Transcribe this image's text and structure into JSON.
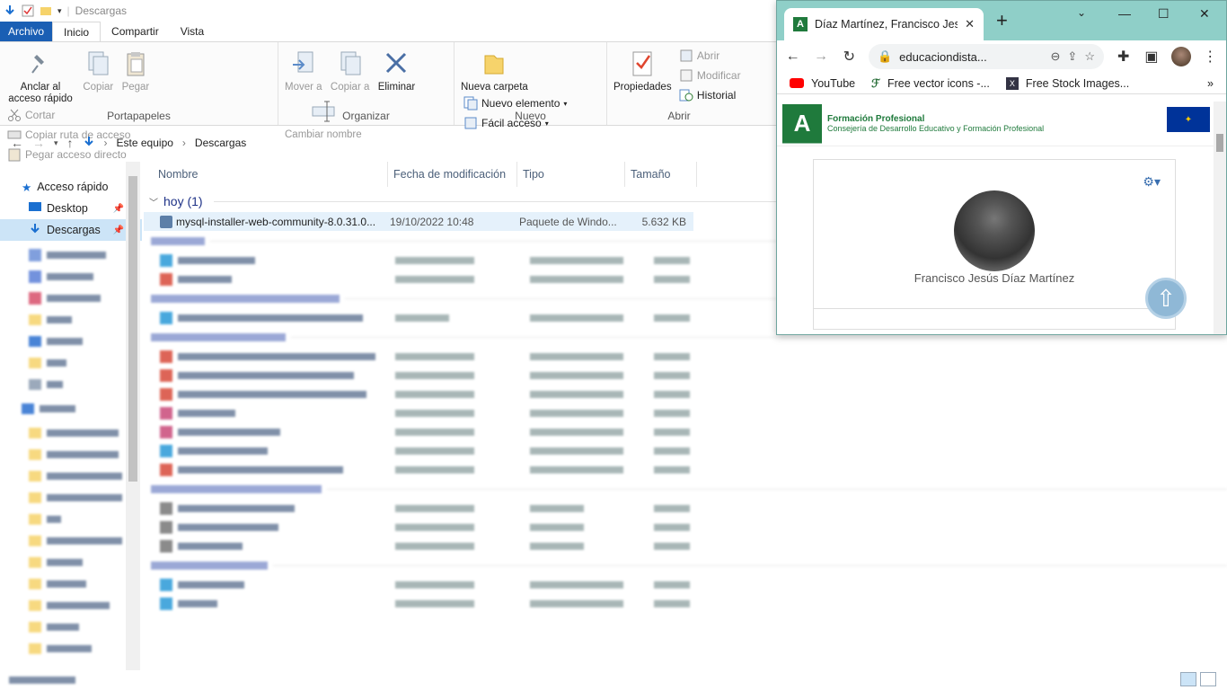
{
  "explorer": {
    "window_title": "Descargas",
    "ribbon_tabs": [
      "Archivo",
      "Inicio",
      "Compartir",
      "Vista"
    ],
    "groups": {
      "portapapeles": {
        "label": "Portapapeles",
        "anclar": "Anclar al acceso rápido",
        "copiar": "Copiar",
        "pegar": "Pegar",
        "cortar": "Cortar",
        "copiar_ruta": "Copiar ruta de acceso",
        "pegar_acceso": "Pegar acceso directo"
      },
      "organizar": {
        "label": "Organizar",
        "mover": "Mover a",
        "copiar_a": "Copiar a",
        "eliminar": "Eliminar",
        "cambiar": "Cambiar nombre"
      },
      "nuevo": {
        "label": "Nuevo",
        "carpeta": "Nueva carpeta",
        "nuevo_elemento": "Nuevo elemento",
        "facil_acceso": "Fácil acceso"
      },
      "abrir": {
        "label": "Abrir",
        "propiedades": "Propiedades",
        "abrir": "Abrir",
        "modificar": "Modificar",
        "historial": "Historial"
      }
    },
    "address": {
      "root": "Este equipo",
      "current": "Descargas"
    },
    "nav": {
      "items": [
        {
          "label": "Acceso rápido",
          "icon": "star-icon",
          "selected": false,
          "pinned": false
        },
        {
          "label": "Desktop",
          "icon": "desktop-icon",
          "selected": false,
          "pinned": true
        },
        {
          "label": "Descargas",
          "icon": "download-icon",
          "selected": true,
          "pinned": true
        }
      ]
    },
    "columns": [
      "Nombre",
      "Fecha de modificación",
      "Tipo",
      "Tamaño"
    ],
    "groups_list": {
      "today": {
        "label": "hoy (1)"
      }
    },
    "files": [
      {
        "name": "mysql-installer-web-community-8.0.31.0...",
        "date": "19/10/2022 10:48",
        "type": "Paquete de Windo...",
        "size": "5.632 KB"
      }
    ]
  },
  "chrome": {
    "tab_title": "Díaz Martínez, Francisco Jesús",
    "url": "educaciondista...",
    "bookmarks": [
      "YouTube",
      "Free vector icons -...",
      "Free Stock Images..."
    ],
    "page": {
      "org_title": "Formación Profesional",
      "org_subtitle": "Consejería de Desarrollo Educativo y Formación Profesional",
      "profile_name": "Francisco Jesús Díaz Martínez"
    }
  },
  "colors": {
    "accent": "#1a5fb4",
    "chrome_frame": "#8fcfc8",
    "brand_green": "#1f7a3c",
    "selection": "#cce4f7"
  }
}
